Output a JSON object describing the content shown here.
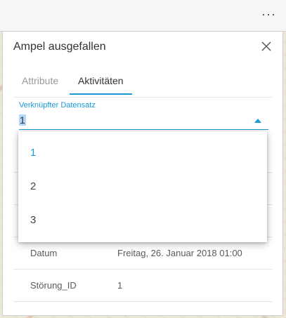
{
  "header": {
    "menu_glyph": "···"
  },
  "panel": {
    "title": "Ampel ausgefallen",
    "tabs": [
      {
        "label": "Attribute",
        "active": false
      },
      {
        "label": "Aktivitäten",
        "active": true
      }
    ],
    "select": {
      "label": "Verknüpfter Datensatz",
      "value": "1",
      "options": [
        "1",
        "2",
        "3"
      ],
      "selected_index": 0
    },
    "attributes": [
      {
        "key": "Datum",
        "value": "Freitag, 26. Januar 2018 01:00"
      },
      {
        "key": "Störung_ID",
        "value": "1"
      }
    ]
  },
  "colors": {
    "accent": "#1a9ad6",
    "text": "#323232",
    "muted": "#9a9a9a"
  }
}
